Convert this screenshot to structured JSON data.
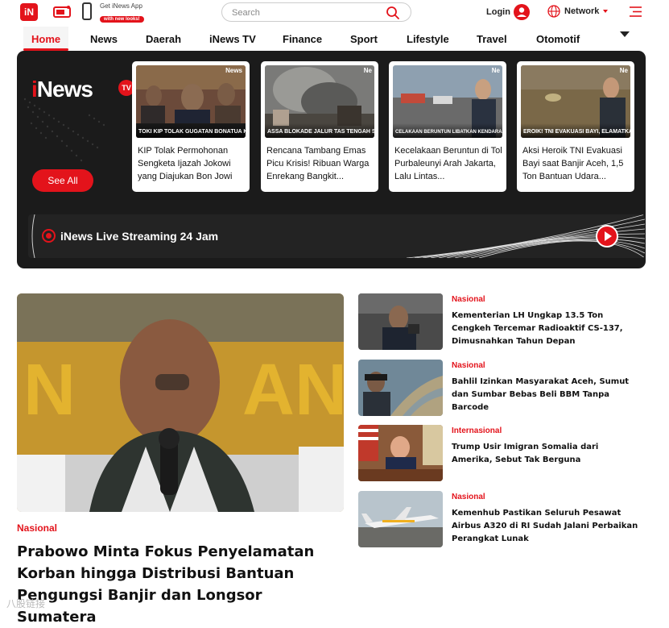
{
  "header": {
    "logo_text": "iN",
    "app_promo": {
      "title": "Get iNews App",
      "subtitle": "with new looks!"
    },
    "search": {
      "placeholder": "Search"
    },
    "login_label": "Login",
    "network_label": "Network",
    "icons": [
      "tv-icon",
      "phone-icon",
      "search-icon",
      "avatar-icon",
      "globe-icon",
      "menu-icon"
    ],
    "accent_color": "#e3131b"
  },
  "nav": {
    "items": [
      "Home",
      "News",
      "Daerah",
      "iNews TV",
      "Finance",
      "Sport",
      "Lifestyle",
      "Travel",
      "Otomotif"
    ],
    "active": "Home"
  },
  "tv": {
    "brand": "iNews",
    "brand_badge": "TV",
    "see_all_label": "See All",
    "videos": [
      {
        "caption": "KIP Tolak Permohonan Sengketa Ijazah Jokowi yang Diajukan Bon Jowi",
        "thumb_text": "TOKI KIP TOLAK GUGATAN BONATUA KE ANRI",
        "thumb_tag": "News"
      },
      {
        "caption": "Rencana Tambang Emas Picu Krisis! Ribuan Warga Enrekang Bangkit...",
        "thumb_text": "ASSA BLOKADE JALUR TAS TENGAH SULAWESI",
        "thumb_tag": "Ne"
      },
      {
        "caption": "Kecelakaan Beruntun di Tol Purbaleunyi Arah Jakarta, Lalu Lintas...",
        "thumb_text": "CELAKAAN BERUNTUN LIBATKAN KENDARAAN DI TOL PURBALEUNYI",
        "thumb_tag": "Ne"
      },
      {
        "caption": "Aksi Heroik TNI Evakuasi Bayi saat Banjir Aceh, 1,5 Ton Bantuan Udara...",
        "thumb_text": "EROIK! TNI EVAKUASI BAYI, ELAMATKAN DARI BANJIR",
        "thumb_tag": "Ne"
      }
    ],
    "live_label": "iNews Live Streaming 24 Jam"
  },
  "headline": {
    "category": "Nasional",
    "title": "Prabowo Minta Fokus Penyelamatan Korban hingga Distribusi Bantuan Pengungsi Banjir dan Longsor Sumatera"
  },
  "side_news": [
    {
      "category": "Nasional",
      "title": "Kementerian LH Ungkap 13.5 Ton Cengkeh Tercemar Radioaktif CS-137, Dimusnahkan Tahun Depan"
    },
    {
      "category": "Nasional",
      "title": "Bahlil Izinkan Masyarakat Aceh, Sumut dan Sumbar Bebas Beli BBM Tanpa Barcode"
    },
    {
      "category": "Internasional",
      "title": "Trump Usir Imigran Somalia dari Amerika, Sebut Tak Berguna"
    },
    {
      "category": "Nasional",
      "title": "Kemenhub Pastikan Seluruh Pesawat Airbus A320 di RI Sudah Jalani Perbaikan Perangkat Lunak"
    }
  ],
  "watermark": "八股链接"
}
